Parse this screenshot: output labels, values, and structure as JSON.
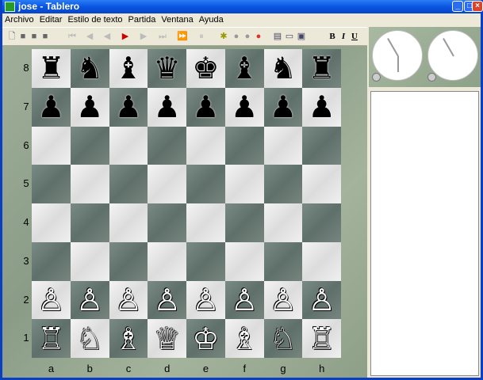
{
  "window": {
    "title": "jose - Tablero",
    "controls": [
      "minimize",
      "maximize",
      "close"
    ]
  },
  "menu": [
    "Archivo",
    "Editar",
    "Estilo de texto",
    "Partida",
    "Ventana",
    "Ayuda"
  ],
  "toolbar": {
    "file": [
      "new-icon",
      "save-icon",
      "save-as-icon",
      "print-icon"
    ],
    "nav": [
      "first-icon",
      "back-fast-icon",
      "back-icon",
      "play-icon",
      "forward-icon",
      "last-icon",
      "fast-forward-icon",
      "pause-icon"
    ],
    "engine": [
      "engine-icon",
      "circle-icon",
      "hint-icon",
      "stop-icon"
    ],
    "view": [
      "doc-icon",
      "window-icon",
      "paste-icon"
    ],
    "format": [
      "B",
      "I",
      "U"
    ]
  },
  "board": {
    "ranks": [
      "8",
      "7",
      "6",
      "5",
      "4",
      "3",
      "2",
      "1"
    ],
    "files": [
      "a",
      "b",
      "c",
      "d",
      "e",
      "f",
      "g",
      "h"
    ],
    "position": [
      "rnbqkbnr",
      "pppppppp",
      "8",
      "8",
      "8",
      "8",
      "PPPPPPPP",
      "RNBQKBNR"
    ]
  },
  "colors": {
    "light_square": "#e8e8e8",
    "dark_square": "#6a7a74",
    "title_bar": "#0a55e0"
  }
}
